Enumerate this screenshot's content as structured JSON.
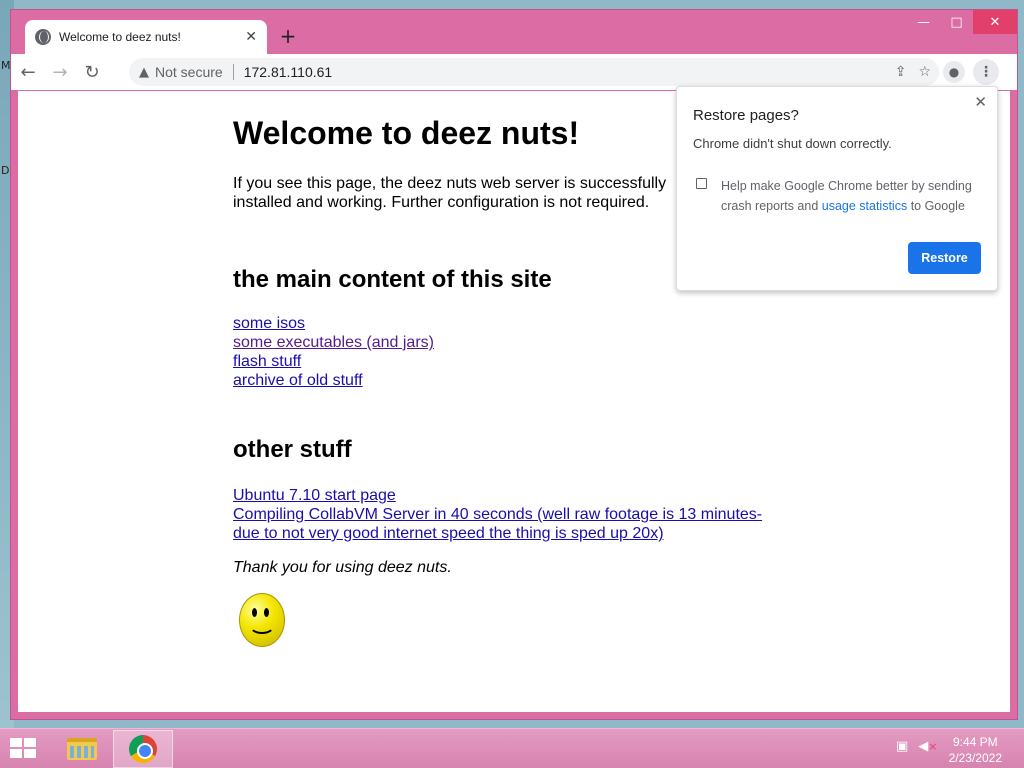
{
  "desktop": {
    "letters": [
      "M",
      "D"
    ]
  },
  "window": {
    "minimize": "—",
    "maximize": "□",
    "close": "✕"
  },
  "tab": {
    "title": "Welcome to deez nuts!",
    "close": "✕",
    "favicon": "globe-icon"
  },
  "new_tab": "+",
  "toolbar": {
    "back": "←",
    "forward": "→",
    "reload": "↻",
    "security": "Not secure",
    "url": "172.81.110.61",
    "share": "⇪",
    "bookmark": "☆",
    "profile": "●",
    "menu": "⋮"
  },
  "page": {
    "heading": "Welcome to deez nuts!",
    "intro": "If you see this page, the deez nuts web server is successfully installed and working. Further configuration is not required.",
    "main_heading": "the main content of this site",
    "main_links": [
      "some isos",
      "some executables (and jars)",
      "flash stuff",
      "archive of old stuff"
    ],
    "other_heading": "other stuff",
    "other_links": [
      "Ubuntu 7.10 start page",
      "Compiling CollabVM Server in 40 seconds (well raw footage is 13 minutes- due to not very good internet speed the thing is sped up 20x)"
    ],
    "thanks": "Thank you for using deez nuts."
  },
  "popup": {
    "title": "Restore pages?",
    "message": "Chrome didn't shut down correctly.",
    "checkbox_checked": false,
    "help_text_before": "Help make Google Chrome better by sending crash reports and ",
    "help_link": "usage statistics",
    "help_text_after": " to Google",
    "close": "✕",
    "button": "Restore"
  },
  "taskbar": {
    "time": "9:44 PM",
    "date": "2/23/2022"
  },
  "colors": {
    "window_frame": "#dc6ca4",
    "accent": "#1a73e8",
    "link": "#1a0dab",
    "visited_link": "#551a8b"
  }
}
